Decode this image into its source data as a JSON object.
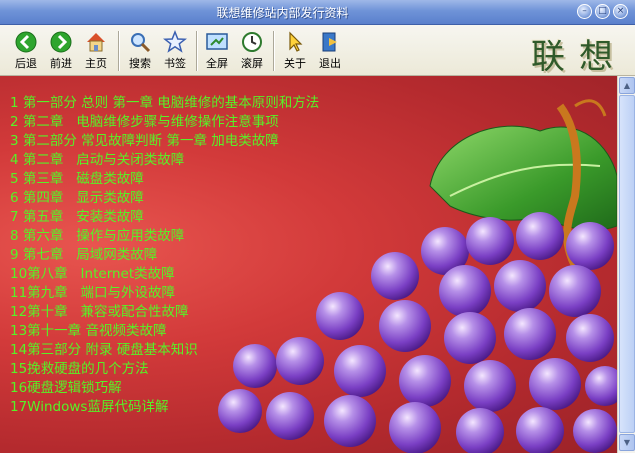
{
  "window": {
    "title": "联想维修站内部发行资料"
  },
  "toolbar": {
    "back": "后退",
    "forward": "前进",
    "home": "主页",
    "search": "搜索",
    "bookmarks": "书签",
    "fullscreen": "全屏",
    "scroll": "滚屏",
    "about": "关于",
    "exit": "退出"
  },
  "brand": "联想",
  "toc": [
    "1 第一部分 总则 第一章 电脑维修的基本原则和方法",
    "2 第二章   电脑维修步骤与维修操作注意事项",
    "3 第二部分 常见故障判断 第一章 加电类故障",
    "4 第二章   启动与关闭类故障",
    "5 第三章   磁盘类故障",
    "6 第四章   显示类故障",
    "7 第五章   安装类故障",
    "8 第六章   操作与应用类故障",
    "9 第七章   局域网类故障",
    "10第八章   Internet类故障",
    "11第九章   端口与外设故障",
    "12第十章   兼容或配合性故障",
    "13第十一章 音视频类故障",
    "14第三部分 附录 硬盘基本知识",
    "15挽救硬盘的几个方法",
    "16硬盘逻辑锁巧解",
    "17Windows蓝屏代码详解"
  ],
  "colors": {
    "toc_text": "#57f227",
    "background": "#d23a3a"
  }
}
